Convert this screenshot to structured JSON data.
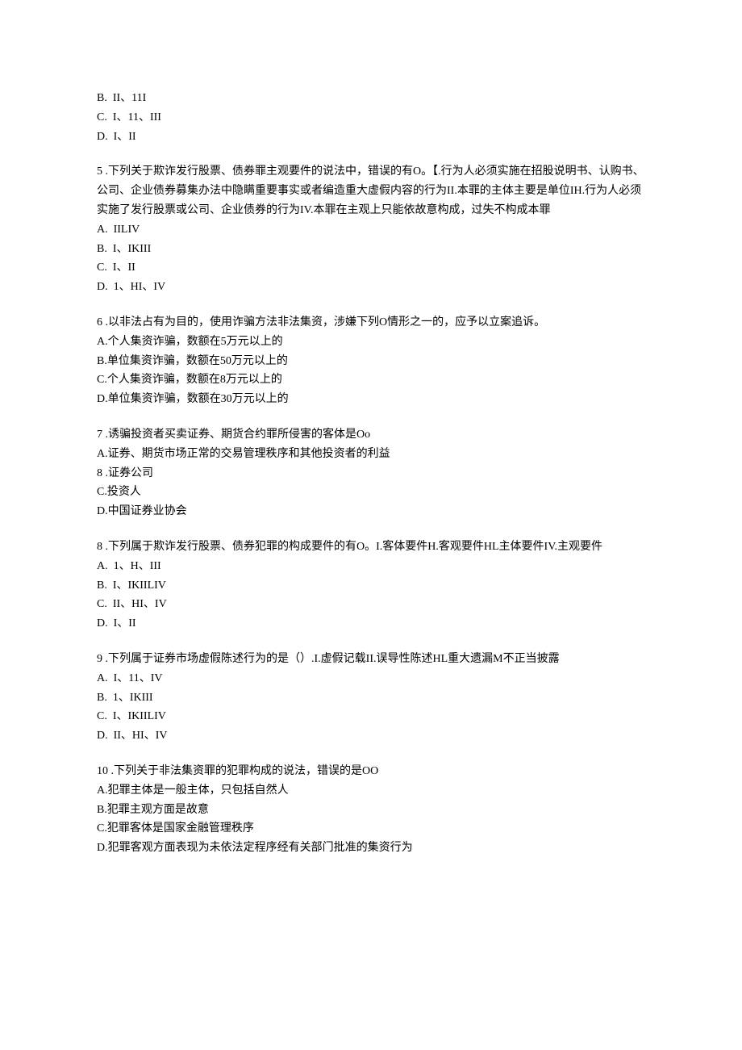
{
  "q4_tail": {
    "optB": "B.  II、11I",
    "optC": "C.  I、11、III",
    "optD": "D.  I、II"
  },
  "q5": {
    "stem": "5 .下列关于欺诈发行股票、债券罪主观要件的说法中，错误的有O。【.行为人必须实施在招股说明书、认购书、公司、企业债券募集办法中隐瞒重要事实或者编造重大虚假内容的行为II.本罪的主体主要是单位IH.行为人必须实施了发行股票或公司、企业债券的行为IV.本罪在主观上只能依故意构成，过失不构成本罪",
    "optA": "A.  IILIV",
    "optB": "B.  I、IKIII",
    "optC": "C.  I、II",
    "optD": "D.  1、HI、IV"
  },
  "q6": {
    "stem": "6 .以非法占有为目的，使用诈骗方法非法集资，涉嫌下列O情形之一的，应予以立案追诉。",
    "optA": "A.个人集资诈骗，数额在5万元以上的",
    "optB": "B.单位集资诈骗，数额在50万元以上的",
    "optC": "C.个人集资诈骗，数额在8万元以上的",
    "optD": "D.单位集资诈骗，数额在30万元以上的"
  },
  "q7": {
    "stem": "7 .诱骗投资者买卖证券、期货合约罪所侵害的客体是Oo",
    "optA": "A.证券、期货市场正常的交易管理秩序和其他投资者的利益",
    "opt8": "8 .证券公司",
    "optC": "C.投资人",
    "optD": "D.中国证券业协会"
  },
  "q8": {
    "stem": "8 .下列属于欺诈发行股票、债券犯罪的构成要件的有O。I.客体要件H.客观要件HL主体要件IV.主观要件",
    "optA": "A.  1、H、III",
    "optB": "B.  I、IKIILIV",
    "optC": "C.  II、HI、IV",
    "optD": "D.  I、II"
  },
  "q9": {
    "stem": "9 .下列属于证券市场虚假陈述行为的是（）.I.虚假记载II.误导性陈述HL重大遗漏M不正当披露",
    "optA": "A.  I、11、IV",
    "optB": "B.  1、IKIII",
    "optC": "C.  I、IKIILIV",
    "optD": "D.  II、HI、IV"
  },
  "q10": {
    "stem": "10 .下列关于非法集资罪的犯罪构成的说法，错误的是OO",
    "optA": "A.犯罪主体是一般主体，只包括自然人",
    "optB": "B.犯罪主观方面是故意",
    "optC": "C.犯罪客体是国家金融管理秩序",
    "optD": "D.犯罪客观方面表现为未依法定程序经有关部门批准的集资行为"
  }
}
